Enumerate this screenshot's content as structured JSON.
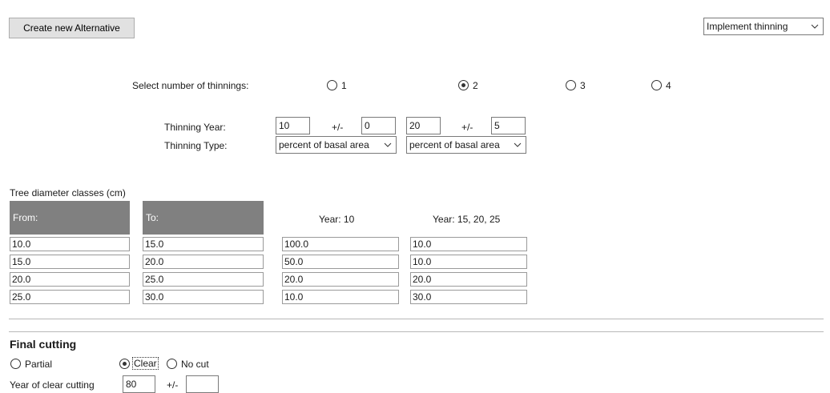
{
  "toolbar": {
    "create_button_label": "Create new Alternative",
    "mode_select_value": "Implement thinning"
  },
  "thinnings": {
    "count_label": "Select number of thinnings:",
    "options": [
      {
        "label": "1",
        "selected": false
      },
      {
        "label": "2",
        "selected": true
      },
      {
        "label": "3",
        "selected": false
      },
      {
        "label": "4",
        "selected": false
      }
    ],
    "year_label": "Thinning Year:",
    "type_label": "Thinning Type:",
    "pm_label": "+/-",
    "columns": [
      {
        "year": "10",
        "tolerance": "0",
        "type": "percent of basal area"
      },
      {
        "year": "20",
        "tolerance": "5",
        "type": "percent of basal area"
      }
    ]
  },
  "diameter_table": {
    "caption": "Tree diameter classes (cm)",
    "headers": {
      "from": "From:",
      "to": "To:",
      "year_a": "Year: 10",
      "year_b": "Year: 15, 20, 25"
    },
    "rows": [
      {
        "from": "10.0",
        "to": "15.0",
        "year_a": "100.0",
        "year_b": "10.0"
      },
      {
        "from": "15.0",
        "to": "20.0",
        "year_a": "50.0",
        "year_b": "10.0"
      },
      {
        "from": "20.0",
        "to": "25.0",
        "year_a": "20.0",
        "year_b": "20.0"
      },
      {
        "from": "25.0",
        "to": "30.0",
        "year_a": "10.0",
        "year_b": "30.0"
      }
    ]
  },
  "final_cutting": {
    "title": "Final cutting",
    "options": [
      {
        "label": "Partial",
        "selected": false
      },
      {
        "label": "Clear",
        "selected": true
      },
      {
        "label": "No cut",
        "selected": false
      }
    ],
    "year_label": "Year of clear cutting",
    "year_value": "80",
    "pm_label": "+/-",
    "tolerance_value": ""
  },
  "icons": {
    "dropdown": "chevron-down-icon",
    "radio": "radio-button-icon"
  },
  "colors": {
    "header_bg": "#808080",
    "button_bg": "#e1e1e1"
  }
}
